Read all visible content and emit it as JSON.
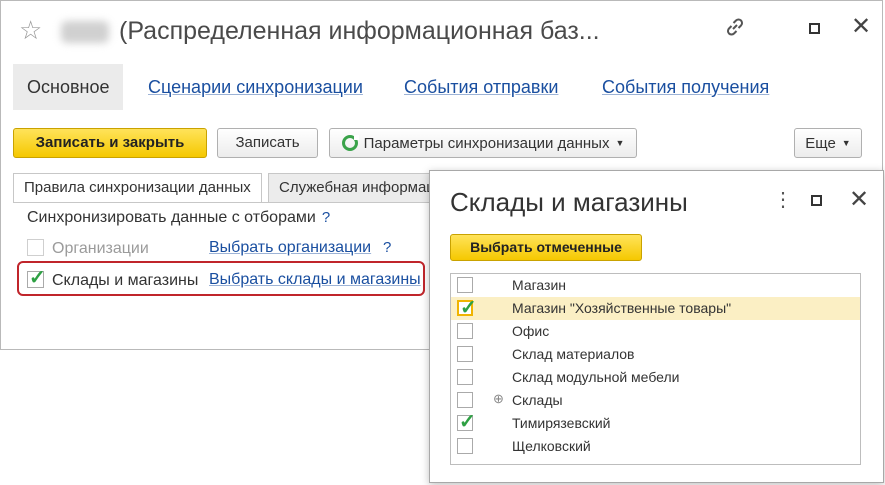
{
  "window": {
    "title": "(Распределенная информационная баз...",
    "title_full": "(Распределенная информационная база)",
    "icons": [
      "star-icon",
      "link-icon",
      "maximize-icon",
      "close-icon"
    ]
  },
  "tabs": [
    {
      "label": "Основное",
      "active": true
    },
    {
      "label": "Сценарии синхронизации",
      "active": false
    },
    {
      "label": "События отправки",
      "active": false
    },
    {
      "label": "События получения",
      "active": false
    }
  ],
  "toolbar": {
    "save_close": "Записать и закрыть",
    "save": "Записать",
    "sync_params": "Параметры синхронизации данных",
    "more": "Еще"
  },
  "subtabs": [
    {
      "label": "Правила синхронизации данных",
      "active": true
    },
    {
      "label": "Служебная информация",
      "active": false
    }
  ],
  "filters": {
    "section_label": "Синхронизировать данные с отборами",
    "help": "?",
    "organizations": {
      "label": "Организации",
      "link": "Выбрать организации",
      "checked": false,
      "enabled": false
    },
    "stores": {
      "label": "Склады и магазины",
      "link": "Выбрать склады и магазины",
      "checked": true
    }
  },
  "popup": {
    "title": "Склады и магазины",
    "select_button": "Выбрать отмеченные",
    "items": [
      {
        "name": "Магазин",
        "checked": false,
        "selected": false,
        "expandable": false
      },
      {
        "name": "Магазин \"Хозяйственные товары\"",
        "checked": true,
        "selected": true,
        "expandable": false
      },
      {
        "name": "Офис",
        "checked": false,
        "selected": false,
        "expandable": false
      },
      {
        "name": "Склад материалов",
        "checked": false,
        "selected": false,
        "expandable": false
      },
      {
        "name": "Склад модульной мебели",
        "checked": false,
        "selected": false,
        "expandable": false
      },
      {
        "name": "Склады",
        "checked": false,
        "selected": false,
        "expandable": true
      },
      {
        "name": "Тимирязевский",
        "checked": true,
        "selected": false,
        "expandable": false
      },
      {
        "name": "Щелковский",
        "checked": false,
        "selected": false,
        "expandable": false
      }
    ]
  },
  "colors": {
    "accent_yellow": "#f5c800",
    "link_blue": "#1a4fa0",
    "highlight_red": "#c0252b",
    "check_green": "#2ea043",
    "selected_row": "#fbefc4"
  }
}
